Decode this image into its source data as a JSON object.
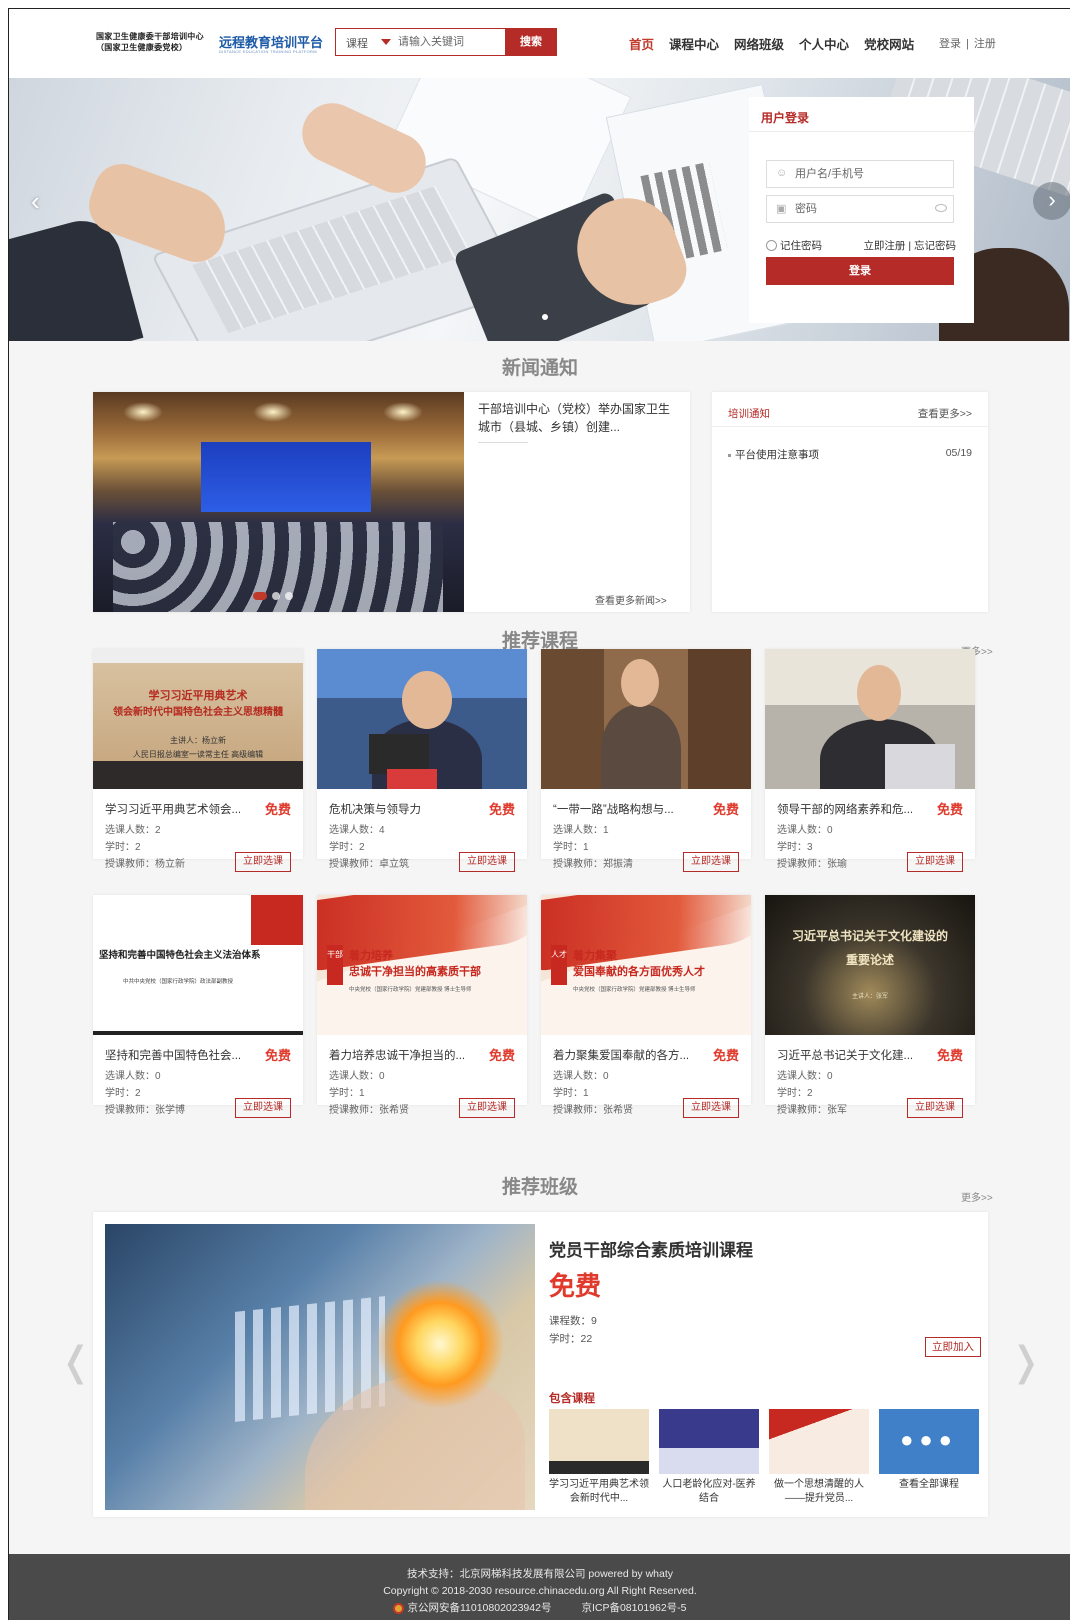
{
  "header": {
    "logo_line1": "国家卫生健康委干部培训中心",
    "logo_line2": "（国家卫生健康委党校）",
    "platform_name": "远程教育培训平台",
    "platform_en": "DISTANCE EDUCATION TRAINING PLATFORM",
    "search": {
      "category": "课程",
      "placeholder": "请输入关键词",
      "button": "搜索"
    },
    "nav": [
      "首页",
      "课程中心",
      "网络班级",
      "个人中心",
      "党校网站"
    ],
    "login": "登录",
    "separator": "|",
    "register": "注册"
  },
  "login_box": {
    "title": "用户登录",
    "username_placeholder": "用户名/手机号",
    "password_placeholder": "密码",
    "remember": "记住密码",
    "register_link": "立即注册",
    "forgot_link": "忘记密码",
    "submit": "登录"
  },
  "news": {
    "section_title": "新闻通知",
    "headline": "干部培训中心（党校）举办国家卫生城市（县城、乡镇）创建...",
    "more": "查看更多新闻>>",
    "notice": {
      "title": "培训通知",
      "more": "查看更多>>",
      "items": [
        {
          "title": "平台使用注意事项",
          "date": "05/19"
        }
      ]
    }
  },
  "courses": {
    "section_title": "推荐课程",
    "more": "更多>>",
    "items": [
      {
        "name": "学习习近平用典艺术领会...",
        "price": "免费",
        "students": "选课人数：2",
        "hours": "学时：2",
        "teacher": "授课教师：杨立新",
        "button": "立即选课",
        "thumb_line1": "学习习近平用典艺术",
        "thumb_line2": "领会新时代中国特色社会主义思想精髓",
        "thumb_line3": "主讲人：杨立新",
        "thumb_line4": "人民日报总编室一读常主任 高级编辑"
      },
      {
        "name": "危机决策与领导力",
        "price": "免费",
        "students": "选课人数：4",
        "hours": "学时：2",
        "teacher": "授课教师：卓立筑",
        "button": "立即选课"
      },
      {
        "name": "“一带一路”战略构想与...",
        "price": "免费",
        "students": "选课人数：1",
        "hours": "学时：1",
        "teacher": "授课教师：郑振清",
        "button": "立即选课"
      },
      {
        "name": "领导干部的网络素养和危...",
        "price": "免费",
        "students": "选课人数：0",
        "hours": "学时：3",
        "teacher": "授课教师：张瑜",
        "button": "立即选课"
      },
      {
        "name": "坚持和完善中国特色社会...",
        "price": "免费",
        "students": "选课人数：0",
        "hours": "学时：2",
        "teacher": "授课教师：张学博",
        "button": "立即选课",
        "thumb_line1": "坚持和完善中国特色社会主义法治体系",
        "thumb_line2": "中共中央党校（国家行政学院）政法部副教授"
      },
      {
        "name": "着力培养忠诚干净担当的...",
        "price": "免费",
        "students": "选课人数：0",
        "hours": "学时：1",
        "teacher": "授课教师：张希贤",
        "button": "立即选课",
        "thumb_seal": "干部",
        "thumb_line1": "着力培养",
        "thumb_line2": "忠诚干净担当的高素质干部",
        "thumb_line3": "中央党校（国家行政学院）党建部教授 博士生导师"
      },
      {
        "name": "着力聚集爱国奉献的各方...",
        "price": "免费",
        "students": "选课人数：0",
        "hours": "学时：1",
        "teacher": "授课教师：张希贤",
        "button": "立即选课",
        "thumb_seal": "人才",
        "thumb_line1": "着力集聚",
        "thumb_line2": "爱国奉献的各方面优秀人才",
        "thumb_line3": "中央党校（国家行政学院）党建部教授 博士生导师"
      },
      {
        "name": "习近平总书记关于文化建...",
        "price": "免费",
        "students": "选课人数：0",
        "hours": "学时：2",
        "teacher": "授课教师：张军",
        "button": "立即选课",
        "thumb_line1": "习近平总书记关于文化建设的",
        "thumb_line2": "重要论述",
        "thumb_line3": "主讲人：张军"
      }
    ]
  },
  "classes": {
    "section_title": "推荐班级",
    "more": "更多>>",
    "name": "党员干部综合素质培训课程",
    "price": "免费",
    "course_count": "课程数：9",
    "hours": "学时：22",
    "join": "立即加入",
    "included_title": "包含课程",
    "included": [
      {
        "label": "学习习近平用典艺术领会新时代中..."
      },
      {
        "label": "人口老龄化应对-医养结合"
      },
      {
        "label": "做一个思想清醒的人——提升党员..."
      },
      {
        "label": "查看全部课程"
      }
    ]
  },
  "footer": {
    "support": "技术支持：北京网梯科技发展有限公司 powered by whaty",
    "copyright": "Copyright © 2018-2030 resource.chinacedu.org All Right Reserved.",
    "police": "京公网安备11010802023942号",
    "icp": "京ICP备08101962号-5"
  }
}
